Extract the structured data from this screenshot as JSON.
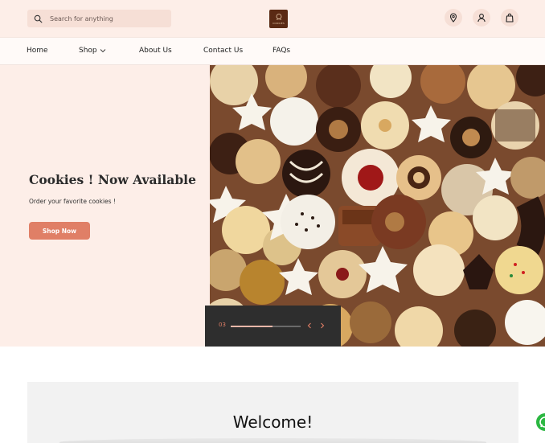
{
  "search": {
    "placeholder": "Search for anything"
  },
  "header": {
    "logo_icon": "cookie-shop-logo",
    "logo_text": "COOKIES",
    "icons": [
      "location-pin-icon",
      "user-icon",
      "shopping-bag-icon"
    ]
  },
  "nav": {
    "items": [
      {
        "label": "Home"
      },
      {
        "label": "Shop",
        "has_dropdown": true
      },
      {
        "label": "About Us"
      },
      {
        "label": "Contact Us"
      },
      {
        "label": "FAQs"
      }
    ]
  },
  "hero": {
    "title": "Cookies ! Now Available",
    "subtitle": "Order your favorite cookies !",
    "cta_label": "Shop Now",
    "image_subject": "assorted-cookies-photo"
  },
  "slider": {
    "current": "03",
    "progress": 0.6
  },
  "welcome": {
    "title": "Welcome!"
  },
  "floating": {
    "whatsapp_icon": "whatsapp-icon"
  },
  "colors": {
    "header_bg": "#fdeee8",
    "accent": "#e07f66",
    "logo_bg": "#5a2a14",
    "slider_bg": "#2e2e2e",
    "section_bg": "#f2f2f2",
    "whatsapp": "#2bb741"
  }
}
